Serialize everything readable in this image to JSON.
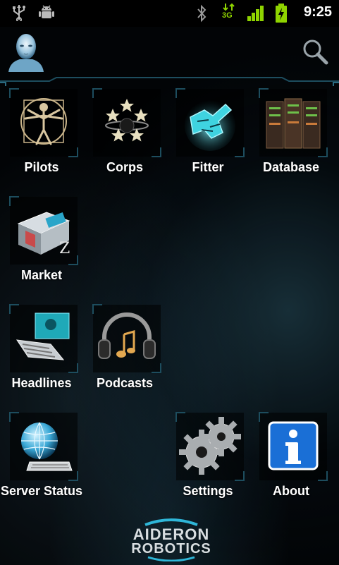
{
  "status_bar": {
    "time": "9:25",
    "network": "3G",
    "icons": [
      "usb-icon",
      "android-debug-icon",
      "bluetooth-icon",
      "data-arrows-icon",
      "signal-icon",
      "battery-charging-icon"
    ]
  },
  "header": {
    "avatar_icon": "pilot-avatar-icon",
    "search_icon": "search-icon"
  },
  "tiles": [
    {
      "label": "Pilots",
      "icon": "pilots-icon"
    },
    {
      "label": "Corps",
      "icon": "corps-icon"
    },
    {
      "label": "Fitter",
      "icon": "fitter-icon"
    },
    {
      "label": "Database",
      "icon": "database-icon"
    },
    {
      "label": "Market",
      "icon": "market-icon"
    },
    {
      "label": "Headlines",
      "icon": "headlines-icon"
    },
    {
      "label": "Podcasts",
      "icon": "podcasts-icon"
    },
    {
      "label": "Server Status",
      "icon": "server-status-icon"
    },
    {
      "label": "Settings",
      "icon": "settings-icon"
    },
    {
      "label": "About",
      "icon": "about-icon"
    }
  ],
  "footer": {
    "logo_line1": "AIDERON",
    "logo_line2": "ROBOTICS"
  },
  "colors": {
    "accent": "#1d4d5e",
    "status_green": "#8fd400",
    "about_blue": "#1a6fd6"
  }
}
